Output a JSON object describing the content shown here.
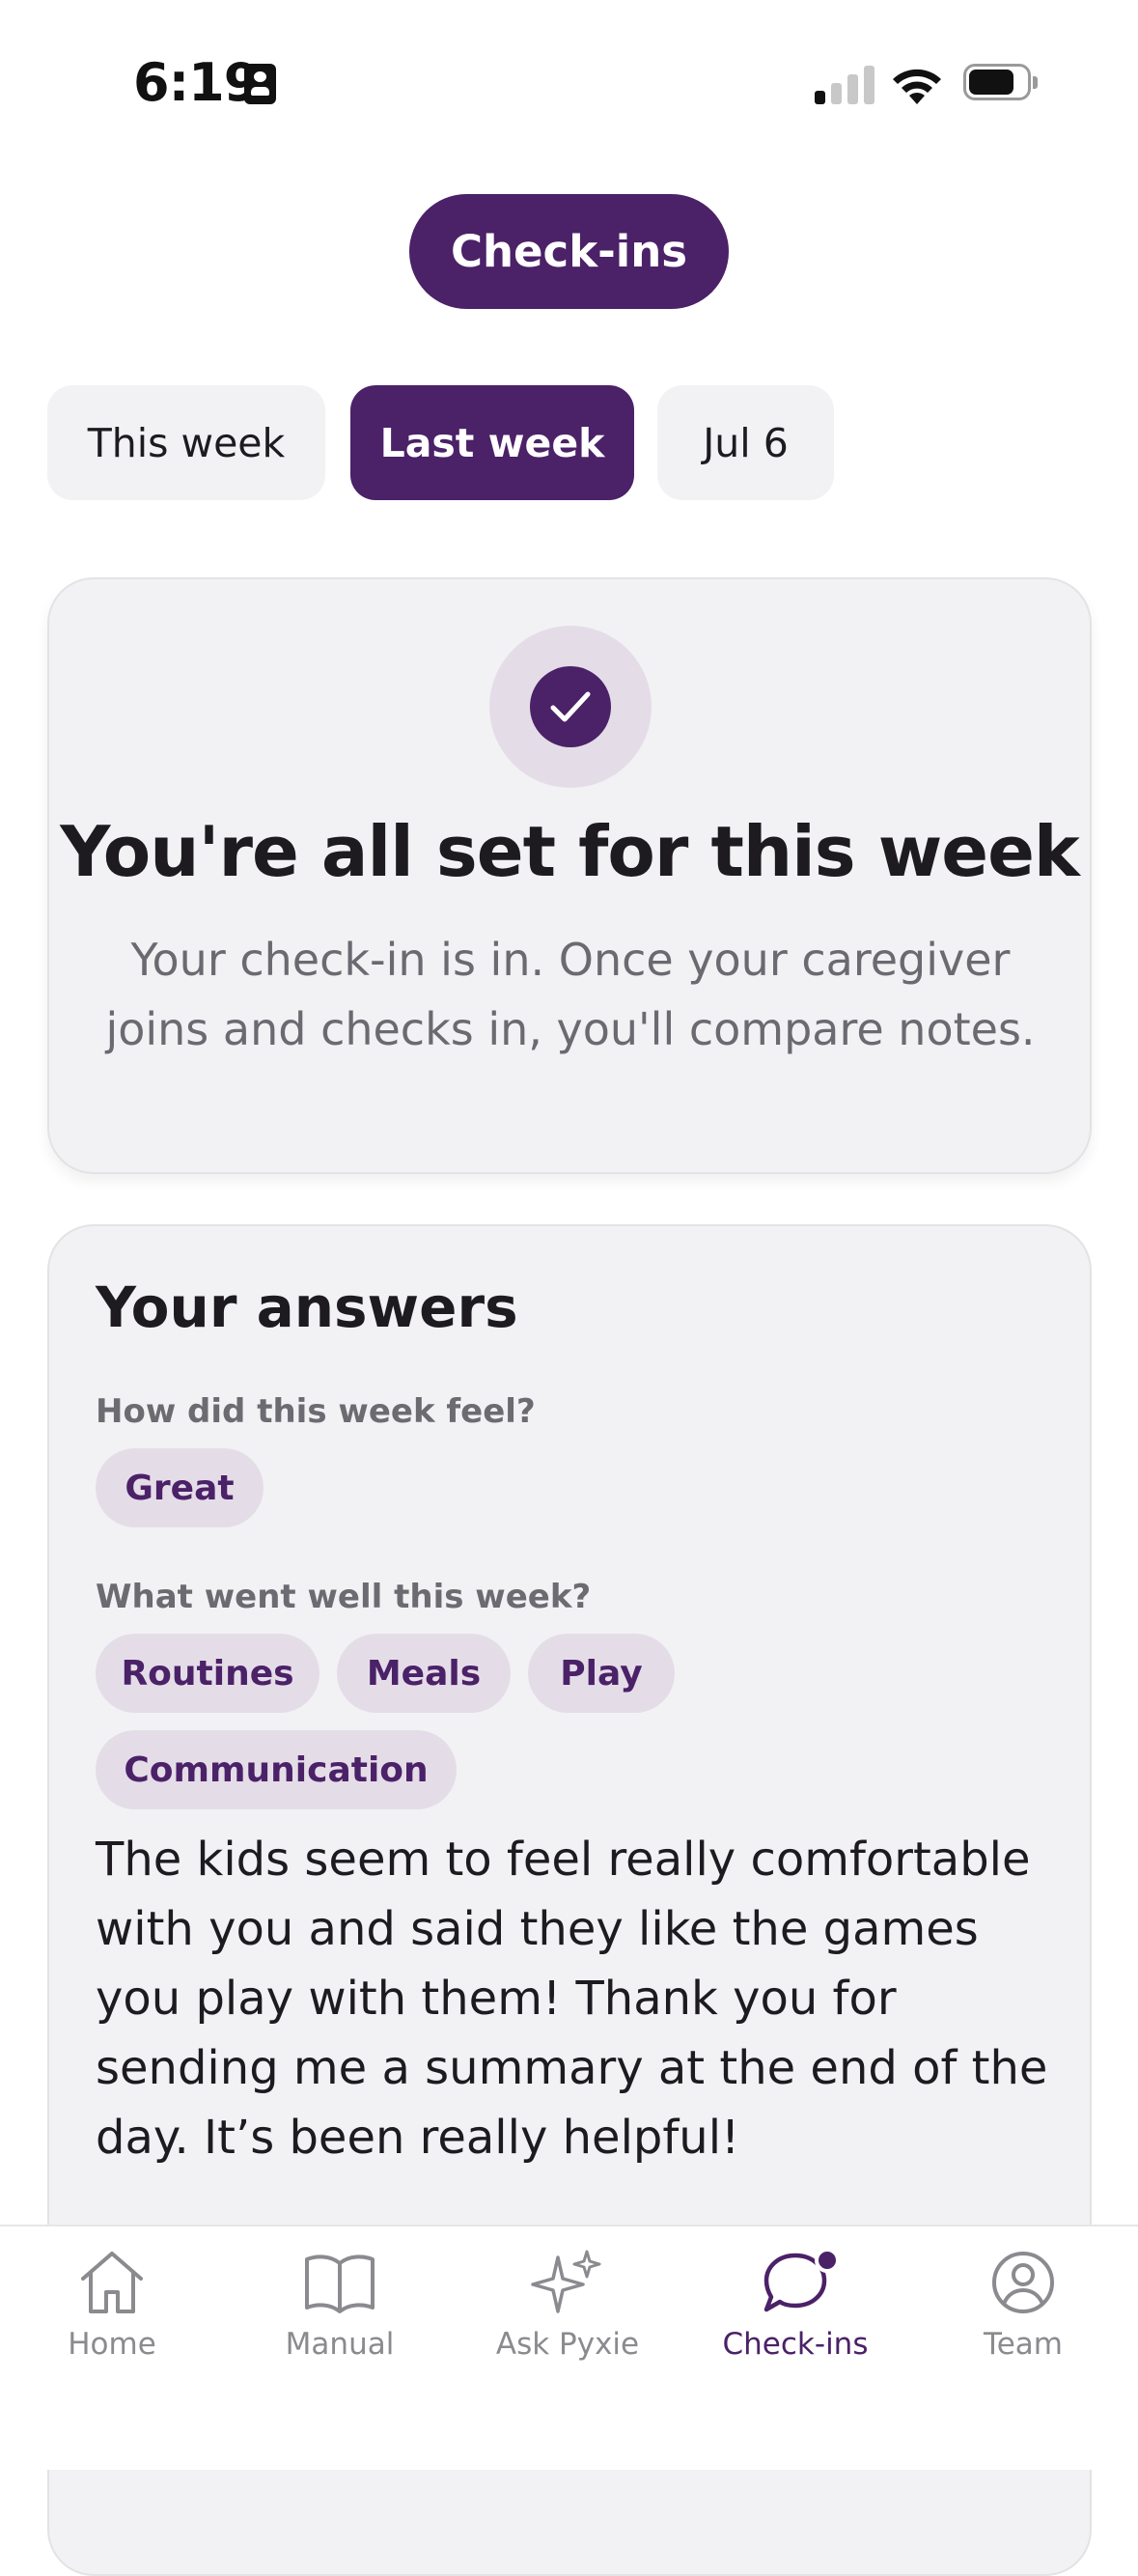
{
  "status_bar": {
    "time": "6:19"
  },
  "header": {
    "title": "Check-ins"
  },
  "week_tabs": [
    {
      "label": "This week",
      "active": false
    },
    {
      "label": "Last week",
      "active": true
    },
    {
      "label": "Jul 6",
      "active": false
    }
  ],
  "status_card": {
    "title": "You're all set for this week",
    "body": "Your check-in is in. Once your caregiver joins and checks in, you'll compare notes."
  },
  "answers": {
    "title": "Your answers",
    "q1": {
      "label": "How did this week feel?",
      "chips": [
        "Great"
      ]
    },
    "q2": {
      "label": "What went well this week?",
      "chips": [
        "Routines",
        "Meals",
        "Play",
        "Communication"
      ]
    },
    "note": "The kids seem to feel really comfortable with you and said they like the games you play with them! Thank you for sending me a summary at the end of the day. It’s been really helpful!"
  },
  "nav": {
    "items": [
      {
        "label": "Home",
        "icon": "home-icon"
      },
      {
        "label": "Manual",
        "icon": "book-icon"
      },
      {
        "label": "Ask Pyxie",
        "icon": "sparkles-icon"
      },
      {
        "label": "Check-ins",
        "icon": "chat-bubble-icon",
        "active": true
      },
      {
        "label": "Team",
        "icon": "user-circle-icon"
      }
    ]
  },
  "colors": {
    "accent": "#4b2168",
    "chip_bg": "#e4dde8",
    "card_bg": "#f2f2f4"
  }
}
